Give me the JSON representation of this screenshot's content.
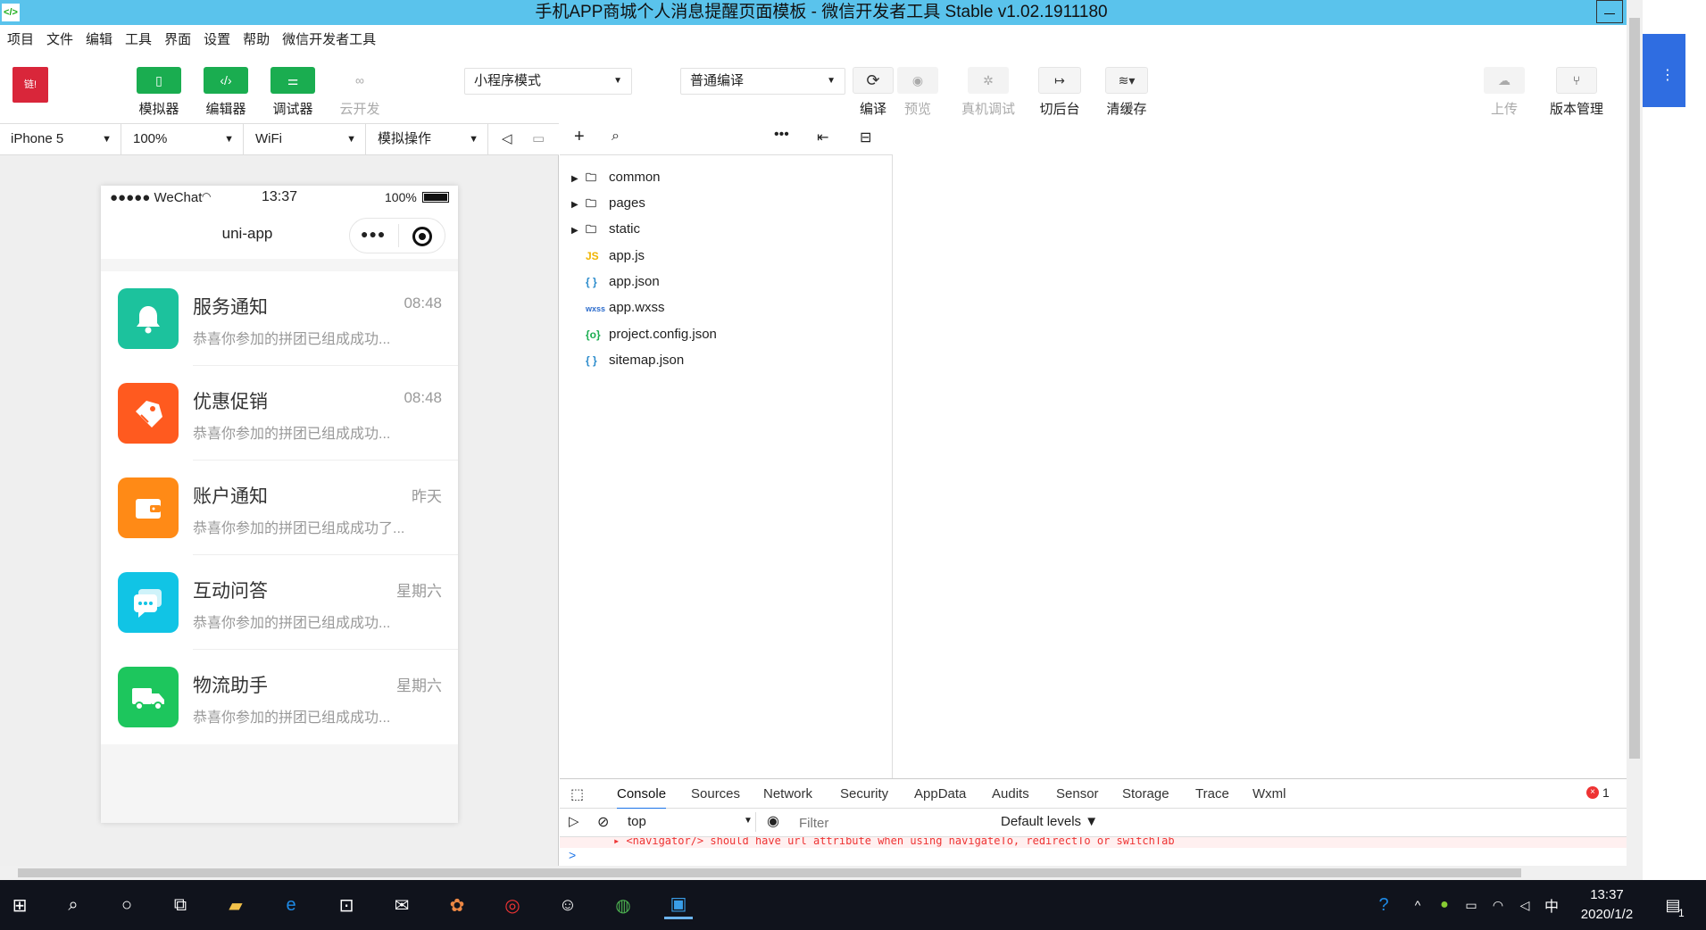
{
  "window": {
    "title": "手机APP商城个人消息提醒页面模板 - 微信开发者工具 Stable v1.02.1911180",
    "app_icon": "</>"
  },
  "menu": [
    "项目",
    "文件",
    "编辑",
    "工具",
    "界面",
    "设置",
    "帮助",
    "微信开发者工具"
  ],
  "toolbar": {
    "avatar_text": "链!",
    "simulator": "模拟器",
    "editor": "编辑器",
    "debugger": "调试器",
    "cloud": "云开发",
    "mode_select": "小程序模式",
    "compile_select": "普通编译",
    "compile": "编译",
    "preview": "预览",
    "real_debug": "真机调试",
    "background": "切后台",
    "clear_cache": "清缓存",
    "upload": "上传",
    "version": "版本管理"
  },
  "devicebar": {
    "device": "iPhone 5",
    "zoom": "100%",
    "network": "WiFi",
    "ops": "模拟操作"
  },
  "phone": {
    "carrier": "●●●●● WeChat",
    "time": "13:37",
    "battery": "100%",
    "nav_title": "uni-app",
    "messages": [
      {
        "title": "服务通知",
        "time": "08:48",
        "desc": "恭喜你参加的拼团已组成成功...",
        "color": "#1cc29d",
        "icon": "bell-icon"
      },
      {
        "title": "优惠促销",
        "time": "08:48",
        "desc": "恭喜你参加的拼团已组成成功...",
        "color": "#ff5a1f",
        "icon": "tag-icon"
      },
      {
        "title": "账户通知",
        "time": "昨天",
        "desc": "恭喜你参加的拼团已组成成功了...",
        "color": "#ff8a16",
        "icon": "wallet-icon"
      },
      {
        "title": "互动问答",
        "time": "星期六",
        "desc": "恭喜你参加的拼团已组成成功...",
        "color": "#11c4e5",
        "icon": "chat-icon"
      },
      {
        "title": "物流助手",
        "time": "星期六",
        "desc": "恭喜你参加的拼团已组成成功...",
        "color": "#1dc65d",
        "icon": "truck-icon"
      }
    ]
  },
  "filetree": {
    "folders": [
      "common",
      "pages",
      "static"
    ],
    "files": [
      {
        "name": "app.js",
        "badge": "JS",
        "color": "#f0b400"
      },
      {
        "name": "app.json",
        "badge": "{ }",
        "color": "#2c8ccc"
      },
      {
        "name": "app.wxss",
        "badge": "wxss",
        "color": "#2c6ccc"
      },
      {
        "name": "project.config.json",
        "badge": "{o}",
        "color": "#1aad50"
      },
      {
        "name": "sitemap.json",
        "badge": "{ }",
        "color": "#2c8ccc"
      }
    ]
  },
  "devtools": {
    "tabs": [
      "Console",
      "Sources",
      "Network",
      "Security",
      "AppData",
      "Audits",
      "Sensor",
      "Storage",
      "Trace",
      "Wxml"
    ],
    "error_count": "1",
    "context": "top",
    "filter_placeholder": "Filter",
    "levels": "Default levels ▼",
    "error_line": "▸ <navigator/> should have url attribute when using navigateTo, redirectTo or switchTab",
    "prompt": ">"
  },
  "taskbar": {
    "time": "13:37",
    "date": "2020/1/2",
    "ime": "中",
    "notif_count": "1"
  }
}
